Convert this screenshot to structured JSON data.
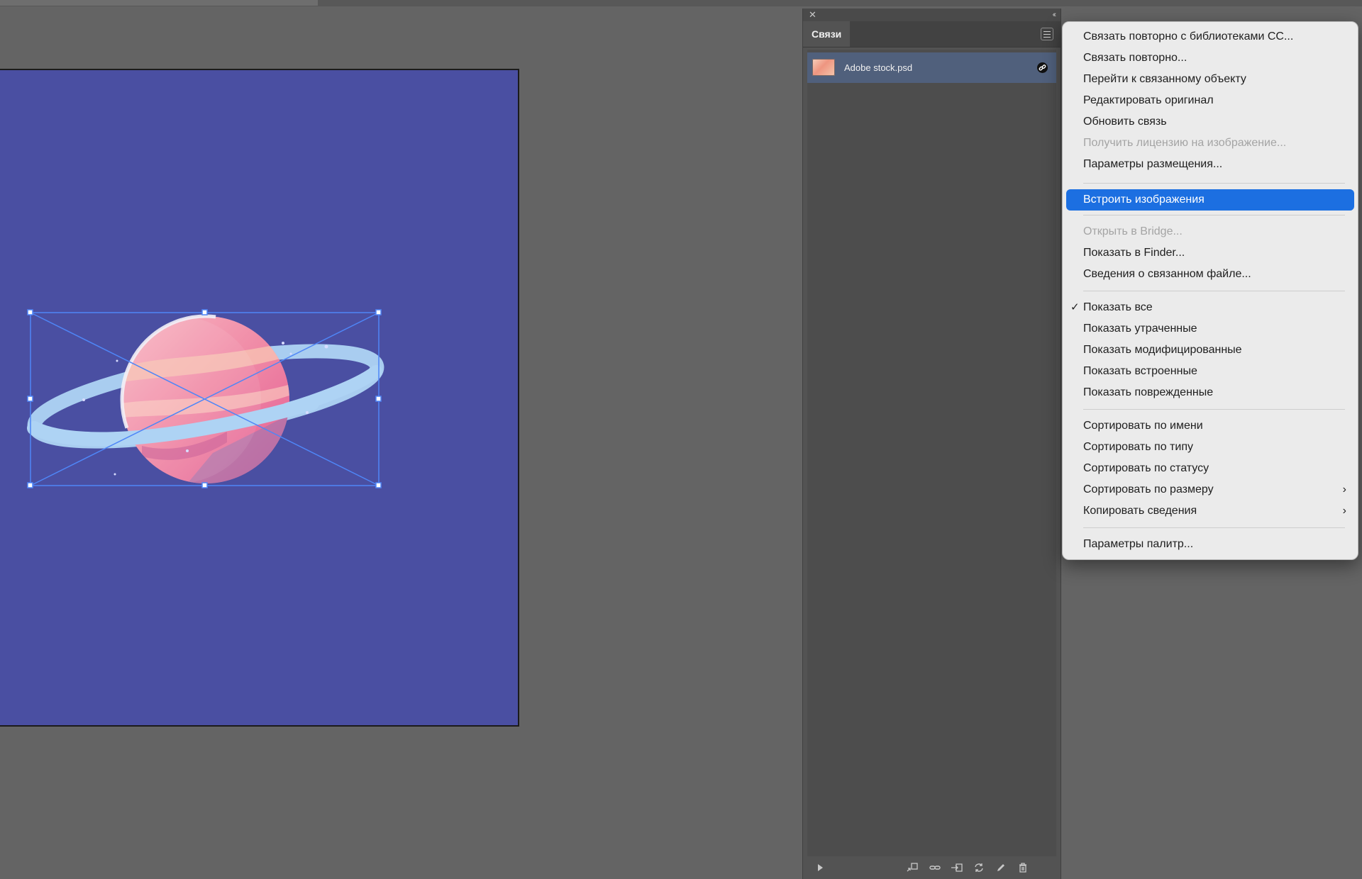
{
  "app": {
    "colors": {
      "canvas": "#646464",
      "artboard": "#4a4fa2",
      "panel": "#535353",
      "selected_row": "#50607c",
      "menu_bg": "#ebebeb",
      "menu_highlight": "#1c6fe1",
      "selection_box": "#4f86f7"
    }
  },
  "canvas": {
    "artwork": {
      "description_icon": "planet-icon",
      "selected": true
    }
  },
  "links_panel": {
    "close_icon": "close-icon",
    "collapse_icon": "double-chevron-icon",
    "tab_label": "Связи",
    "menu_icon": "hamburger-icon",
    "items": [
      {
        "name": "Adobe stock.psd",
        "status_icon": "linked-icon",
        "selected": true
      }
    ],
    "footer_icons": [
      "play-icon",
      "relink-cc-icon",
      "relink-icon",
      "go-to-link-icon",
      "update-link-icon",
      "edit-original-icon",
      "trash-icon"
    ]
  },
  "context_menu": {
    "items": [
      {
        "label": "Связать повторно с библиотеками CC..."
      },
      {
        "label": "Связать повторно..."
      },
      {
        "label": "Перейти к связанному объекту"
      },
      {
        "label": "Редактировать оригинал"
      },
      {
        "label": "Обновить связь"
      },
      {
        "label": "Получить лицензию на изображение...",
        "disabled": true
      },
      {
        "label": "Параметры размещения..."
      },
      {
        "label": "Встроить изображения",
        "highlighted": true
      },
      {
        "label": "Открыть в Bridge...",
        "disabled": true
      },
      {
        "label": "Показать в Finder..."
      },
      {
        "label": "Сведения о связанном файле..."
      },
      {
        "label": "Показать все",
        "checked": true
      },
      {
        "label": "Показать утраченные"
      },
      {
        "label": "Показать модифицированные"
      },
      {
        "label": "Показать встроенные"
      },
      {
        "label": "Показать поврежденные"
      },
      {
        "label": "Сортировать по имени"
      },
      {
        "label": "Сортировать по типу"
      },
      {
        "label": "Сортировать по статусу"
      },
      {
        "label": "Сортировать по размеру",
        "submenu": true
      },
      {
        "label": "Копировать сведения",
        "submenu": true
      },
      {
        "label": "Параметры палитр..."
      }
    ],
    "check_glyph": "✓",
    "submenu_glyph": "›"
  }
}
